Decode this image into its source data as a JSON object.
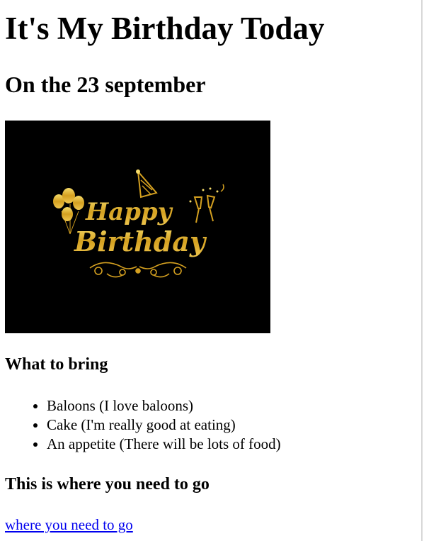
{
  "page": {
    "title": "It's My Birthday Today",
    "subtitle": "On the 23 september"
  },
  "banner": {
    "line1": "Happy",
    "line2": "Birthday",
    "colors": {
      "background": "#000000",
      "gold": "#d4a020",
      "gold_light": "#f6dc6a"
    },
    "icons": [
      "balloons-icon",
      "party-hat-icon",
      "champagne-glasses-icon",
      "ornament-flourish-icon"
    ]
  },
  "bring": {
    "heading": "What to bring",
    "items": [
      "Baloons (I love baloons)",
      "Cake (I'm really good at eating)",
      "An appetite (There will be lots of food)"
    ]
  },
  "directions": {
    "heading": "This is where you need to go",
    "link_text": "where you need to go"
  },
  "colors": {
    "link": "#0000ee",
    "text": "#000000"
  }
}
